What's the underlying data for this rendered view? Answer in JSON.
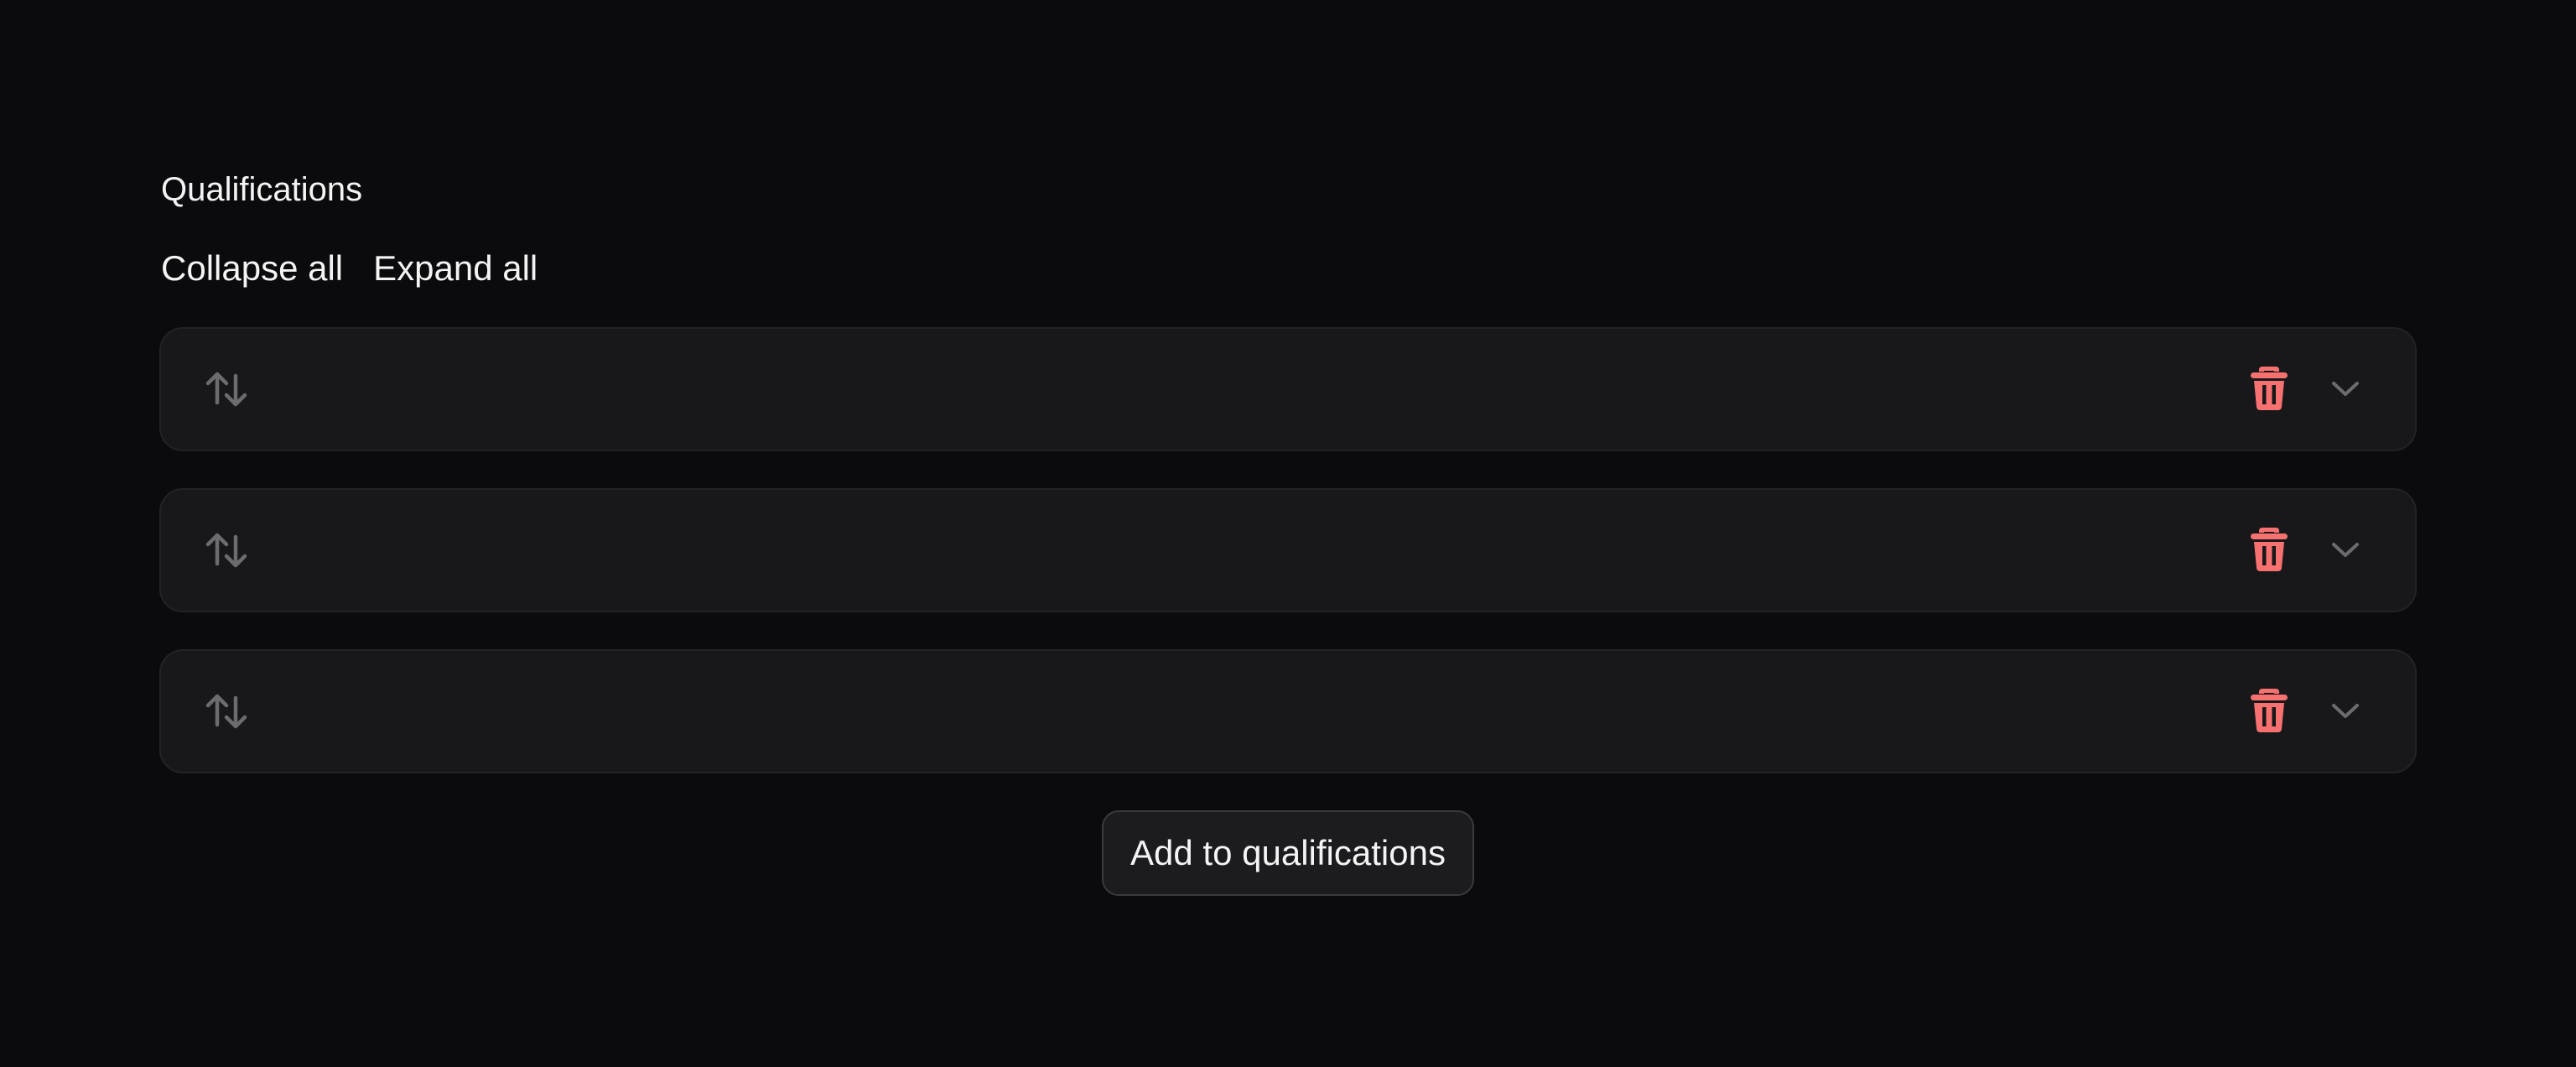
{
  "field": {
    "label": "Qualifications"
  },
  "toolbar": {
    "collapse_all": "Collapse all",
    "expand_all": "Expand all"
  },
  "rows": [
    {
      "drag_icon": "arrows-up-down-icon",
      "delete_icon": "trash-icon",
      "expand_icon": "chevron-down-icon"
    },
    {
      "drag_icon": "arrows-up-down-icon",
      "delete_icon": "trash-icon",
      "expand_icon": "chevron-down-icon"
    },
    {
      "drag_icon": "arrows-up-down-icon",
      "delete_icon": "trash-icon",
      "expand_icon": "chevron-down-icon"
    }
  ],
  "add_button": {
    "label": "Add to qualifications"
  },
  "colors": {
    "background": "#0b0b0d",
    "row_background": "#18181a",
    "delete": "#f87171",
    "muted_icon": "#6b6b70",
    "text": "#f4f4f5"
  }
}
